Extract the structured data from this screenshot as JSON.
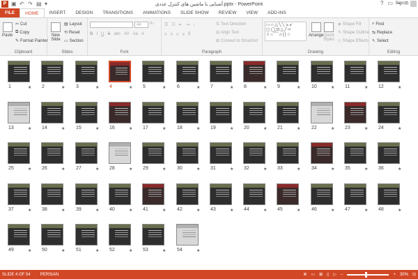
{
  "window": {
    "title": "آشنایی با ماشین های کنترل عددی.pptx - PowerPoint",
    "app_icon": "P",
    "minimize": "–",
    "maximize": "□",
    "close": "✕",
    "help": "?"
  },
  "tabs": [
    "FILE",
    "HOME",
    "INSERT",
    "DESIGN",
    "TRANSITIONS",
    "ANIMATIONS",
    "SLIDE SHOW",
    "REVIEW",
    "VIEW",
    "ADD-INS"
  ],
  "active_tab": "HOME",
  "signin": "Sign in",
  "ribbon": {
    "clipboard": {
      "label": "Clipboard",
      "paste": "Paste",
      "cut": "Cut",
      "copy": "Copy",
      "format_painter": "Format Painter"
    },
    "slides": {
      "label": "Slides",
      "new_slide": "New Slide",
      "layout": "Layout",
      "reset": "Reset",
      "section": "Section"
    },
    "font": {
      "label": "Font",
      "size": "44",
      "bold": "B",
      "italic": "I",
      "underline": "U",
      "strike": "S",
      "shadow": "abc",
      "spacing": "AV",
      "case": "Aa",
      "color": "A"
    },
    "paragraph": {
      "label": "Paragraph",
      "text_direction": "Text Direction",
      "align_text": "Align Text",
      "convert": "Convert to SmartArt"
    },
    "drawing": {
      "label": "Drawing",
      "arrange": "Arrange",
      "quick_styles": "Quick Styles",
      "shape_fill": "Shape Fill",
      "shape_outline": "Shape Outline",
      "shape_effects": "Shape Effects",
      "shapes_glyphs": "▭▱△╲╲↘↙ ▢◯⊡△╱⇨ ⇩⌂⌒⊃{}☆"
    },
    "editing": {
      "label": "Editing",
      "find": "Find",
      "replace": "Replace",
      "select": "Select"
    }
  },
  "slides": [
    {
      "n": "1",
      "style": "dark"
    },
    {
      "n": "2",
      "style": "dark"
    },
    {
      "n": "3",
      "style": "dark"
    },
    {
      "n": "4",
      "style": "red",
      "selected": true
    },
    {
      "n": "5",
      "style": "dark"
    },
    {
      "n": "6",
      "style": "dark"
    },
    {
      "n": "7",
      "style": "dark"
    },
    {
      "n": "8",
      "style": "red"
    },
    {
      "n": "9",
      "style": "dark"
    },
    {
      "n": "10",
      "style": "dark"
    },
    {
      "n": "11",
      "style": "dark"
    },
    {
      "n": "12",
      "style": "dark"
    },
    {
      "n": "13",
      "style": "light"
    },
    {
      "n": "14",
      "style": "dark"
    },
    {
      "n": "15",
      "style": "dark"
    },
    {
      "n": "16",
      "style": "red"
    },
    {
      "n": "17",
      "style": "dark"
    },
    {
      "n": "18",
      "style": "dark"
    },
    {
      "n": "19",
      "style": "dark"
    },
    {
      "n": "20",
      "style": "dark"
    },
    {
      "n": "21",
      "style": "dark"
    },
    {
      "n": "22",
      "style": "light"
    },
    {
      "n": "23",
      "style": "red"
    },
    {
      "n": "24",
      "style": "dark"
    },
    {
      "n": "25",
      "style": "dark"
    },
    {
      "n": "26",
      "style": "dark"
    },
    {
      "n": "27",
      "style": "dark"
    },
    {
      "n": "28",
      "style": "light"
    },
    {
      "n": "29",
      "style": "dark"
    },
    {
      "n": "30",
      "style": "dark"
    },
    {
      "n": "31",
      "style": "dark"
    },
    {
      "n": "32",
      "style": "dark"
    },
    {
      "n": "33",
      "style": "dark"
    },
    {
      "n": "34",
      "style": "red"
    },
    {
      "n": "35",
      "style": "dark"
    },
    {
      "n": "36",
      "style": "dark"
    },
    {
      "n": "37",
      "style": "dark"
    },
    {
      "n": "38",
      "style": "dark"
    },
    {
      "n": "39",
      "style": "dark"
    },
    {
      "n": "40",
      "style": "dark"
    },
    {
      "n": "41",
      "style": "red"
    },
    {
      "n": "42",
      "style": "dark"
    },
    {
      "n": "43",
      "style": "dark"
    },
    {
      "n": "44",
      "style": "dark"
    },
    {
      "n": "45",
      "style": "red"
    },
    {
      "n": "46",
      "style": "dark"
    },
    {
      "n": "47",
      "style": "dark"
    },
    {
      "n": "48",
      "style": "dark"
    },
    {
      "n": "49",
      "style": "dark"
    },
    {
      "n": "50",
      "style": "dark"
    },
    {
      "n": "51",
      "style": "dark"
    },
    {
      "n": "52",
      "style": "dark"
    },
    {
      "n": "53",
      "style": "dark"
    },
    {
      "n": "54",
      "style": "light"
    }
  ],
  "star": "★",
  "status": {
    "slide_of": "SLIDE 4 OF 54",
    "language": "PERSIAN",
    "zoom": "30%",
    "zoom_minus": "–",
    "zoom_plus": "+"
  },
  "colors": {
    "accent": "#d24726"
  }
}
